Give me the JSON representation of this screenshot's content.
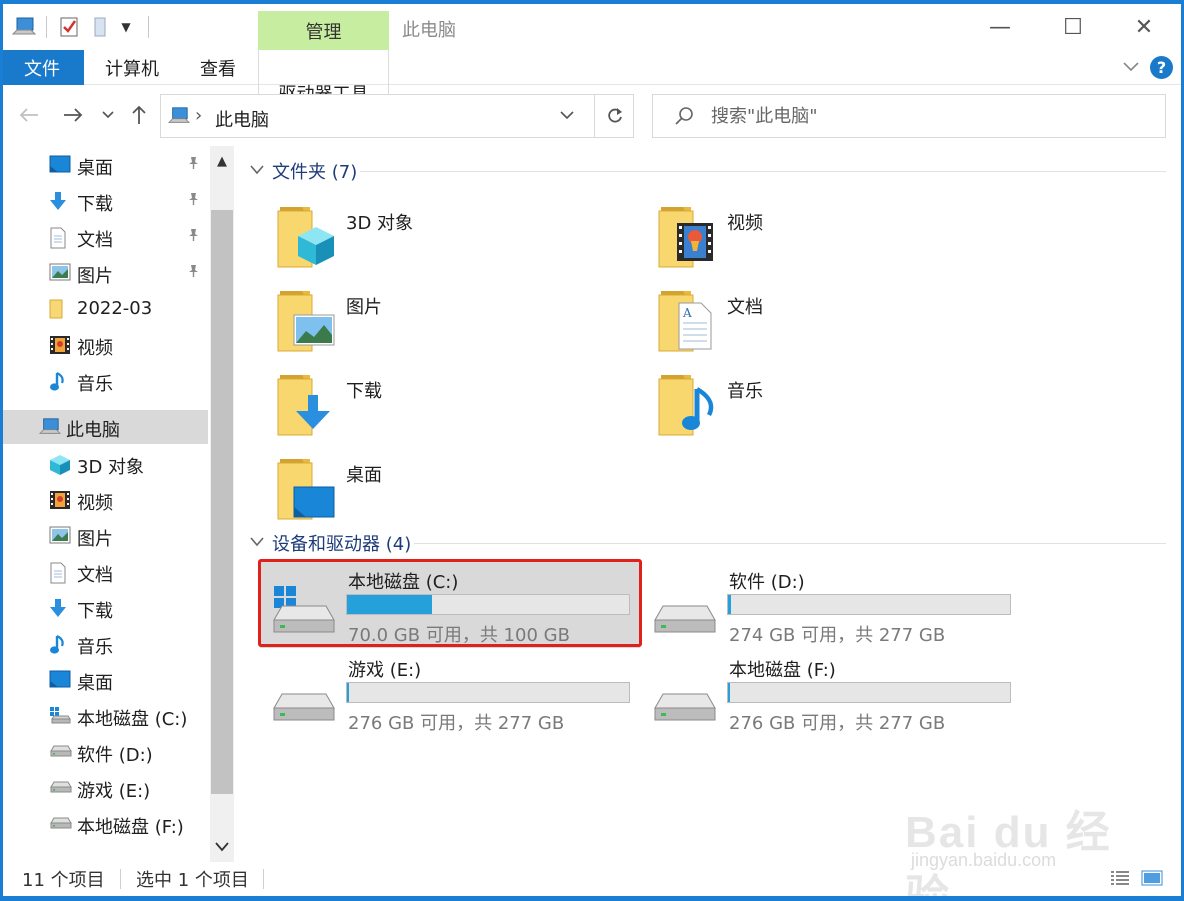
{
  "window": {
    "title": "此电脑",
    "manage_tab": "管理",
    "minimize": "—",
    "maximize": "☐",
    "close": "✕"
  },
  "ribbon": {
    "tabs": [
      {
        "label": "文件"
      },
      {
        "label": "计算机"
      },
      {
        "label": "查看"
      },
      {
        "label": "驱动器工具"
      }
    ],
    "help": "?"
  },
  "address": {
    "crumb": "此电脑",
    "search_placeholder": "搜索\"此电脑\""
  },
  "sidebar": {
    "quick_access": [
      {
        "label": "桌面",
        "icon": "desktop-icon",
        "pinned": true
      },
      {
        "label": "下载",
        "icon": "download-icon",
        "pinned": true
      },
      {
        "label": "文档",
        "icon": "document-icon",
        "pinned": true
      },
      {
        "label": "图片",
        "icon": "picture-icon",
        "pinned": true
      },
      {
        "label": "2022-03",
        "icon": "folder-icon",
        "pinned": false
      },
      {
        "label": "视频",
        "icon": "video-icon",
        "pinned": false
      },
      {
        "label": "音乐",
        "icon": "music-icon",
        "pinned": false
      }
    ],
    "this_pc": {
      "label": "此电脑",
      "icon": "computer-icon"
    },
    "pc_children": [
      {
        "label": "3D 对象",
        "icon": "cube-icon"
      },
      {
        "label": "视频",
        "icon": "video-icon"
      },
      {
        "label": "图片",
        "icon": "picture-icon"
      },
      {
        "label": "文档",
        "icon": "document-icon"
      },
      {
        "label": "下载",
        "icon": "download-icon"
      },
      {
        "label": "音乐",
        "icon": "music-icon"
      },
      {
        "label": "桌面",
        "icon": "desktop-icon"
      },
      {
        "label": "本地磁盘 (C:)",
        "icon": "windows-drive-icon"
      },
      {
        "label": "软件 (D:)",
        "icon": "drive-icon"
      },
      {
        "label": "游戏 (E:)",
        "icon": "drive-icon"
      },
      {
        "label": "本地磁盘 (F:)",
        "icon": "drive-icon"
      }
    ]
  },
  "main": {
    "folders_header": "文件夹 (7)",
    "folders": [
      {
        "label": "3D 对象",
        "overlay": "cube"
      },
      {
        "label": "视频",
        "overlay": "video"
      },
      {
        "label": "图片",
        "overlay": "picture"
      },
      {
        "label": "文档",
        "overlay": "document"
      },
      {
        "label": "下载",
        "overlay": "download"
      },
      {
        "label": "音乐",
        "overlay": "music"
      },
      {
        "label": "桌面",
        "overlay": "desktop"
      }
    ],
    "drives_header": "设备和驱动器 (4)",
    "drives": [
      {
        "name": "本地磁盘 (C:)",
        "space": "70.0 GB 可用，共 100 GB",
        "used_fraction": 0.3,
        "windows": true,
        "selected": true
      },
      {
        "name": "软件 (D:)",
        "space": "274 GB 可用，共 277 GB",
        "used_fraction": 0.011,
        "windows": false,
        "selected": false
      },
      {
        "name": "游戏 (E:)",
        "space": "276 GB 可用，共 277 GB",
        "used_fraction": 0.0036,
        "windows": false,
        "selected": false
      },
      {
        "name": "本地磁盘 (F:)",
        "space": "276 GB 可用，共 277 GB",
        "used_fraction": 0.0036,
        "windows": false,
        "selected": false
      }
    ]
  },
  "status": {
    "items": "11 个项目",
    "selected": "选中 1 个项目"
  },
  "watermark": {
    "big": "Bai du 经验",
    "small": "jingyan.baidu.com"
  },
  "colors": {
    "accent": "#1979ca",
    "manage_tab": "#c7eea0",
    "drive_fill": "#26a0da",
    "highlight": "#e0201b"
  }
}
